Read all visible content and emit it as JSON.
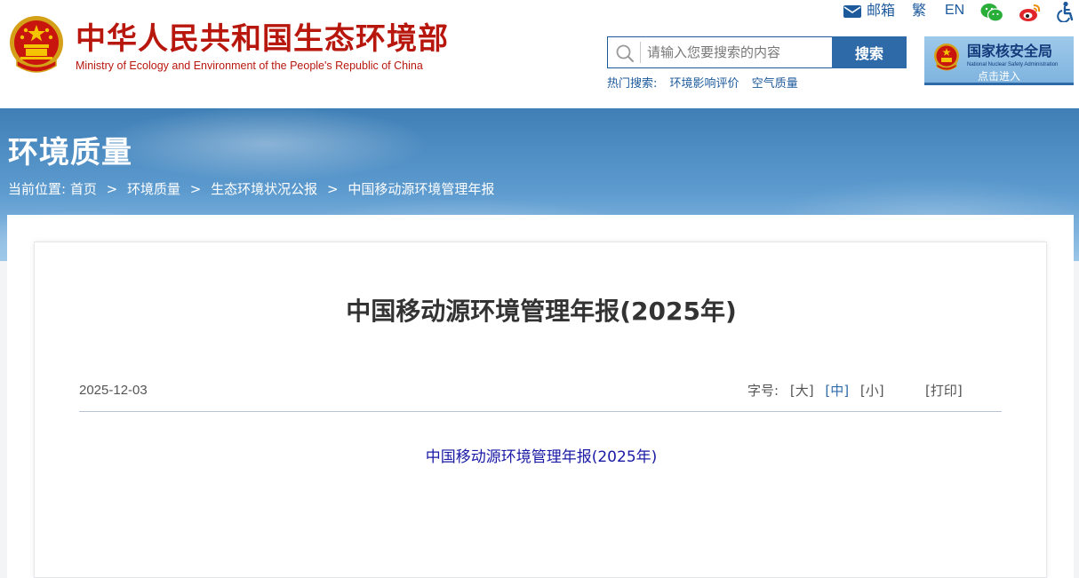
{
  "header": {
    "title_cn": "中华人民共和国生态环境部",
    "title_en": "Ministry of Ecology and Environment of the People's Republic of China",
    "emblem_icon": "national-emblem-icon",
    "brand_color": "#b8170e"
  },
  "toplinks": {
    "mail_label": "邮箱",
    "traditional_label": "繁",
    "english_label": "EN",
    "icons": [
      "mail-icon",
      "wechat-icon",
      "weibo-icon",
      "accessibility-icon"
    ]
  },
  "search": {
    "placeholder": "请输入您要搜索的内容",
    "value": "",
    "button_label": "搜索",
    "hot_label": "热门搜索:",
    "hot_links": [
      "环境影响评价",
      "空气质量"
    ]
  },
  "nnsa": {
    "name_cn": "国家核安全局",
    "name_en": "National Nuclear Safety Administration",
    "enter_label": "点击进入"
  },
  "banner": {
    "title": "环境质量",
    "breadcrumb_label": "当前位置:",
    "breadcrumb": [
      "首页",
      "环境质量",
      "生态环境状况公报",
      "中国移动源环境管理年报"
    ],
    "separator": ">"
  },
  "article": {
    "title": "中国移动源环境管理年报(2025年)",
    "date": "2025-12-03",
    "font_size_label": "字号:",
    "font_sizes": [
      "[大]",
      "[中]",
      "[小]"
    ],
    "active_font_size": "[中]",
    "print_label": "[打印]",
    "doc_link": "中国移动源环境管理年报(2025年)"
  },
  "colors": {
    "accent": "#2e6aa8",
    "link": "#1a1aa6",
    "wechat": "#2aae3a",
    "weibo": "#e0262a"
  }
}
